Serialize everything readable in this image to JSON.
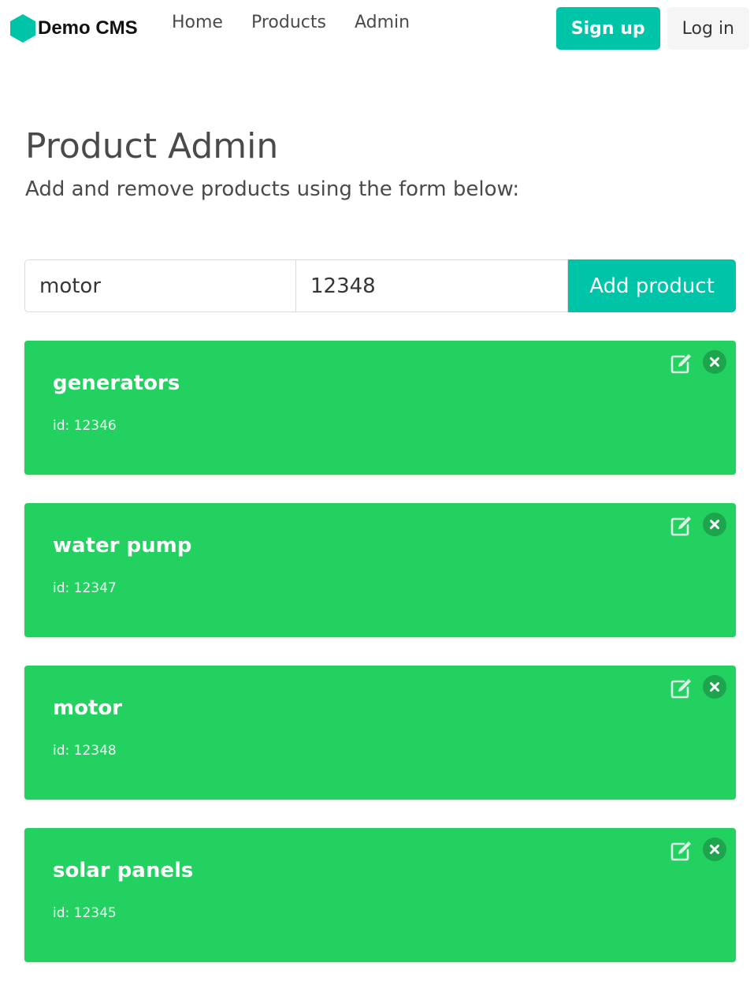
{
  "brand": {
    "name": "Demo CMS",
    "logo_icon": "hexagon-logo-icon",
    "logo_color": "#00c4a7"
  },
  "nav": {
    "links": [
      {
        "label": "Home"
      },
      {
        "label": "Products"
      },
      {
        "label": "Admin"
      }
    ],
    "signup_label": "Sign up",
    "login_label": "Log in"
  },
  "hero": {
    "title": "Product Admin",
    "subtitle": "Add and remove products using the form below:"
  },
  "form": {
    "name_value": "motor",
    "id_value": "12348",
    "add_label": "Add product"
  },
  "products": [
    {
      "name": "generators",
      "id_label": "id:",
      "id": "12346"
    },
    {
      "name": "water pump",
      "id_label": "id:",
      "id": "12347"
    },
    {
      "name": "motor",
      "id_label": "id:",
      "id": "12348"
    },
    {
      "name": "solar panels",
      "id_label": "id:",
      "id": "12345"
    }
  ],
  "colors": {
    "accent": "#00c4a7",
    "card": "#23d160",
    "text": "#4a4a4a"
  },
  "icons": {
    "edit": "edit-icon",
    "delete": "close-icon"
  }
}
